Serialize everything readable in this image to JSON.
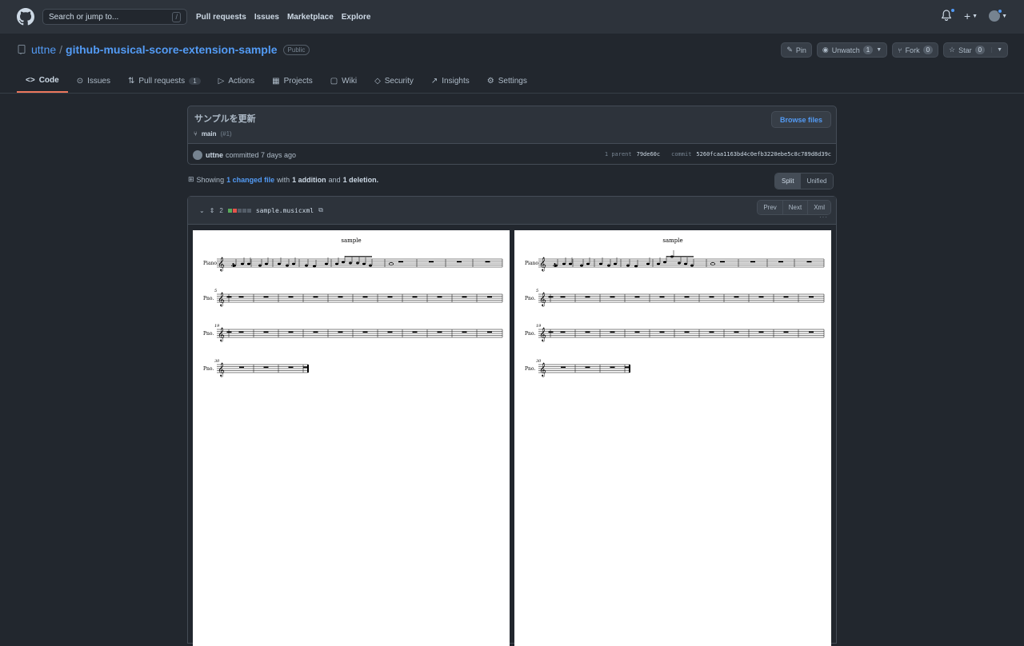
{
  "header": {
    "search_placeholder": "Search or jump to...",
    "search_key": "/",
    "nav": [
      "Pull requests",
      "Issues",
      "Marketplace",
      "Explore"
    ]
  },
  "repo": {
    "owner": "uttne",
    "separator": "/",
    "name": "github-musical-score-extension-sample",
    "visibility": "Public",
    "pin_label": "Pin",
    "unwatch_label": "Unwatch",
    "unwatch_count": "1",
    "fork_label": "Fork",
    "fork_count": "0",
    "star_label": "Star",
    "star_count": "0"
  },
  "tabs": [
    {
      "label": "Code",
      "icon": "code-icon"
    },
    {
      "label": "Issues",
      "icon": "issue-icon"
    },
    {
      "label": "Pull requests",
      "icon": "pr-icon",
      "count": "1"
    },
    {
      "label": "Actions",
      "icon": "play-icon"
    },
    {
      "label": "Projects",
      "icon": "table-icon"
    },
    {
      "label": "Wiki",
      "icon": "book-icon"
    },
    {
      "label": "Security",
      "icon": "shield-icon"
    },
    {
      "label": "Insights",
      "icon": "graph-icon"
    },
    {
      "label": "Settings",
      "icon": "gear-icon"
    }
  ],
  "commit": {
    "title": "サンプルを更新",
    "branch": "main",
    "pr_ref": "(#1)",
    "browse_label": "Browse files",
    "author": "uttne",
    "action": "committed 7 days ago",
    "parent_label": "1 parent",
    "parent_hash": "79de60c",
    "commit_label": "commit",
    "commit_hash": "5260fcaa1163bd4c0efb3220ebe5c8c789d8d39c"
  },
  "diffstat": {
    "showing": "Showing",
    "changed": "1 changed file",
    "with": "with",
    "additions": "1 addition",
    "and": "and",
    "deletions": "1 deletion."
  },
  "view_toggle": {
    "split": "Split",
    "unified": "Unified"
  },
  "file": {
    "change_count": "2",
    "name": "sample.musicxml",
    "prev": "Prev",
    "next": "Next",
    "xml": "Xml",
    "more": "···"
  },
  "scores": {
    "title": "sample",
    "first_instrument": "Piano",
    "instrument_abbr": "Pno.",
    "measure_numbers": [
      "5",
      "19",
      "30"
    ]
  },
  "colors": {
    "accent": "#539bf5",
    "tab_underline": "#ec775c",
    "added": "#57ab5a",
    "removed": "#e5534b"
  }
}
